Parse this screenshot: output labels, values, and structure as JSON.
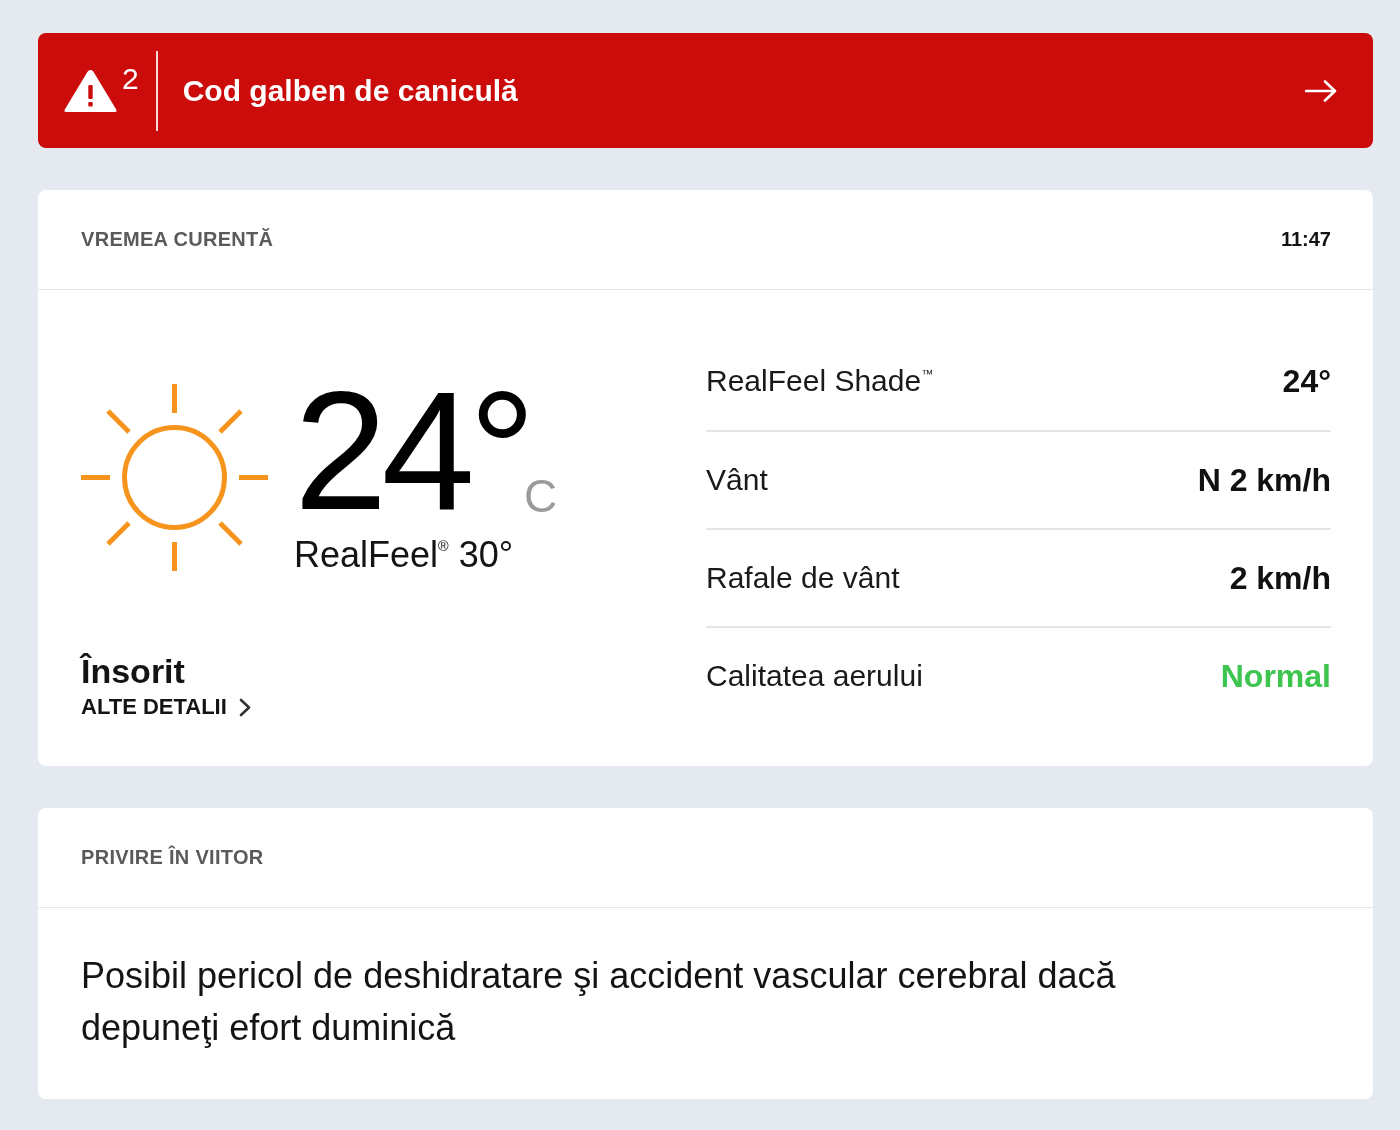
{
  "alert": {
    "count": "2",
    "title": "Cod galben de caniculă"
  },
  "current": {
    "heading": "VREMEA CURENTĂ",
    "time": "11:47",
    "temperature": "24°",
    "unit": "C",
    "realfeel": "RealFeel$^{®}$ 30°",
    "condition": "Însorit",
    "details_link": "ALTE DETALII",
    "details": [
      {
        "label": "RealFeel Shade$^{™}$",
        "value": "24°"
      },
      {
        "label": "Vânt",
        "value": "N 2 km/h"
      },
      {
        "label": "Rafale de vânt",
        "value": "2 km/h"
      },
      {
        "label": "Calitatea aerului",
        "value": "Normal",
        "color": "#3dc54f"
      }
    ]
  },
  "outlook": {
    "heading": "PRIVIRE ÎN VIITOR",
    "text": "Posibil pericol de deshidratare şi accident vascular cerebral dacă depuneţi efort duminică"
  }
}
